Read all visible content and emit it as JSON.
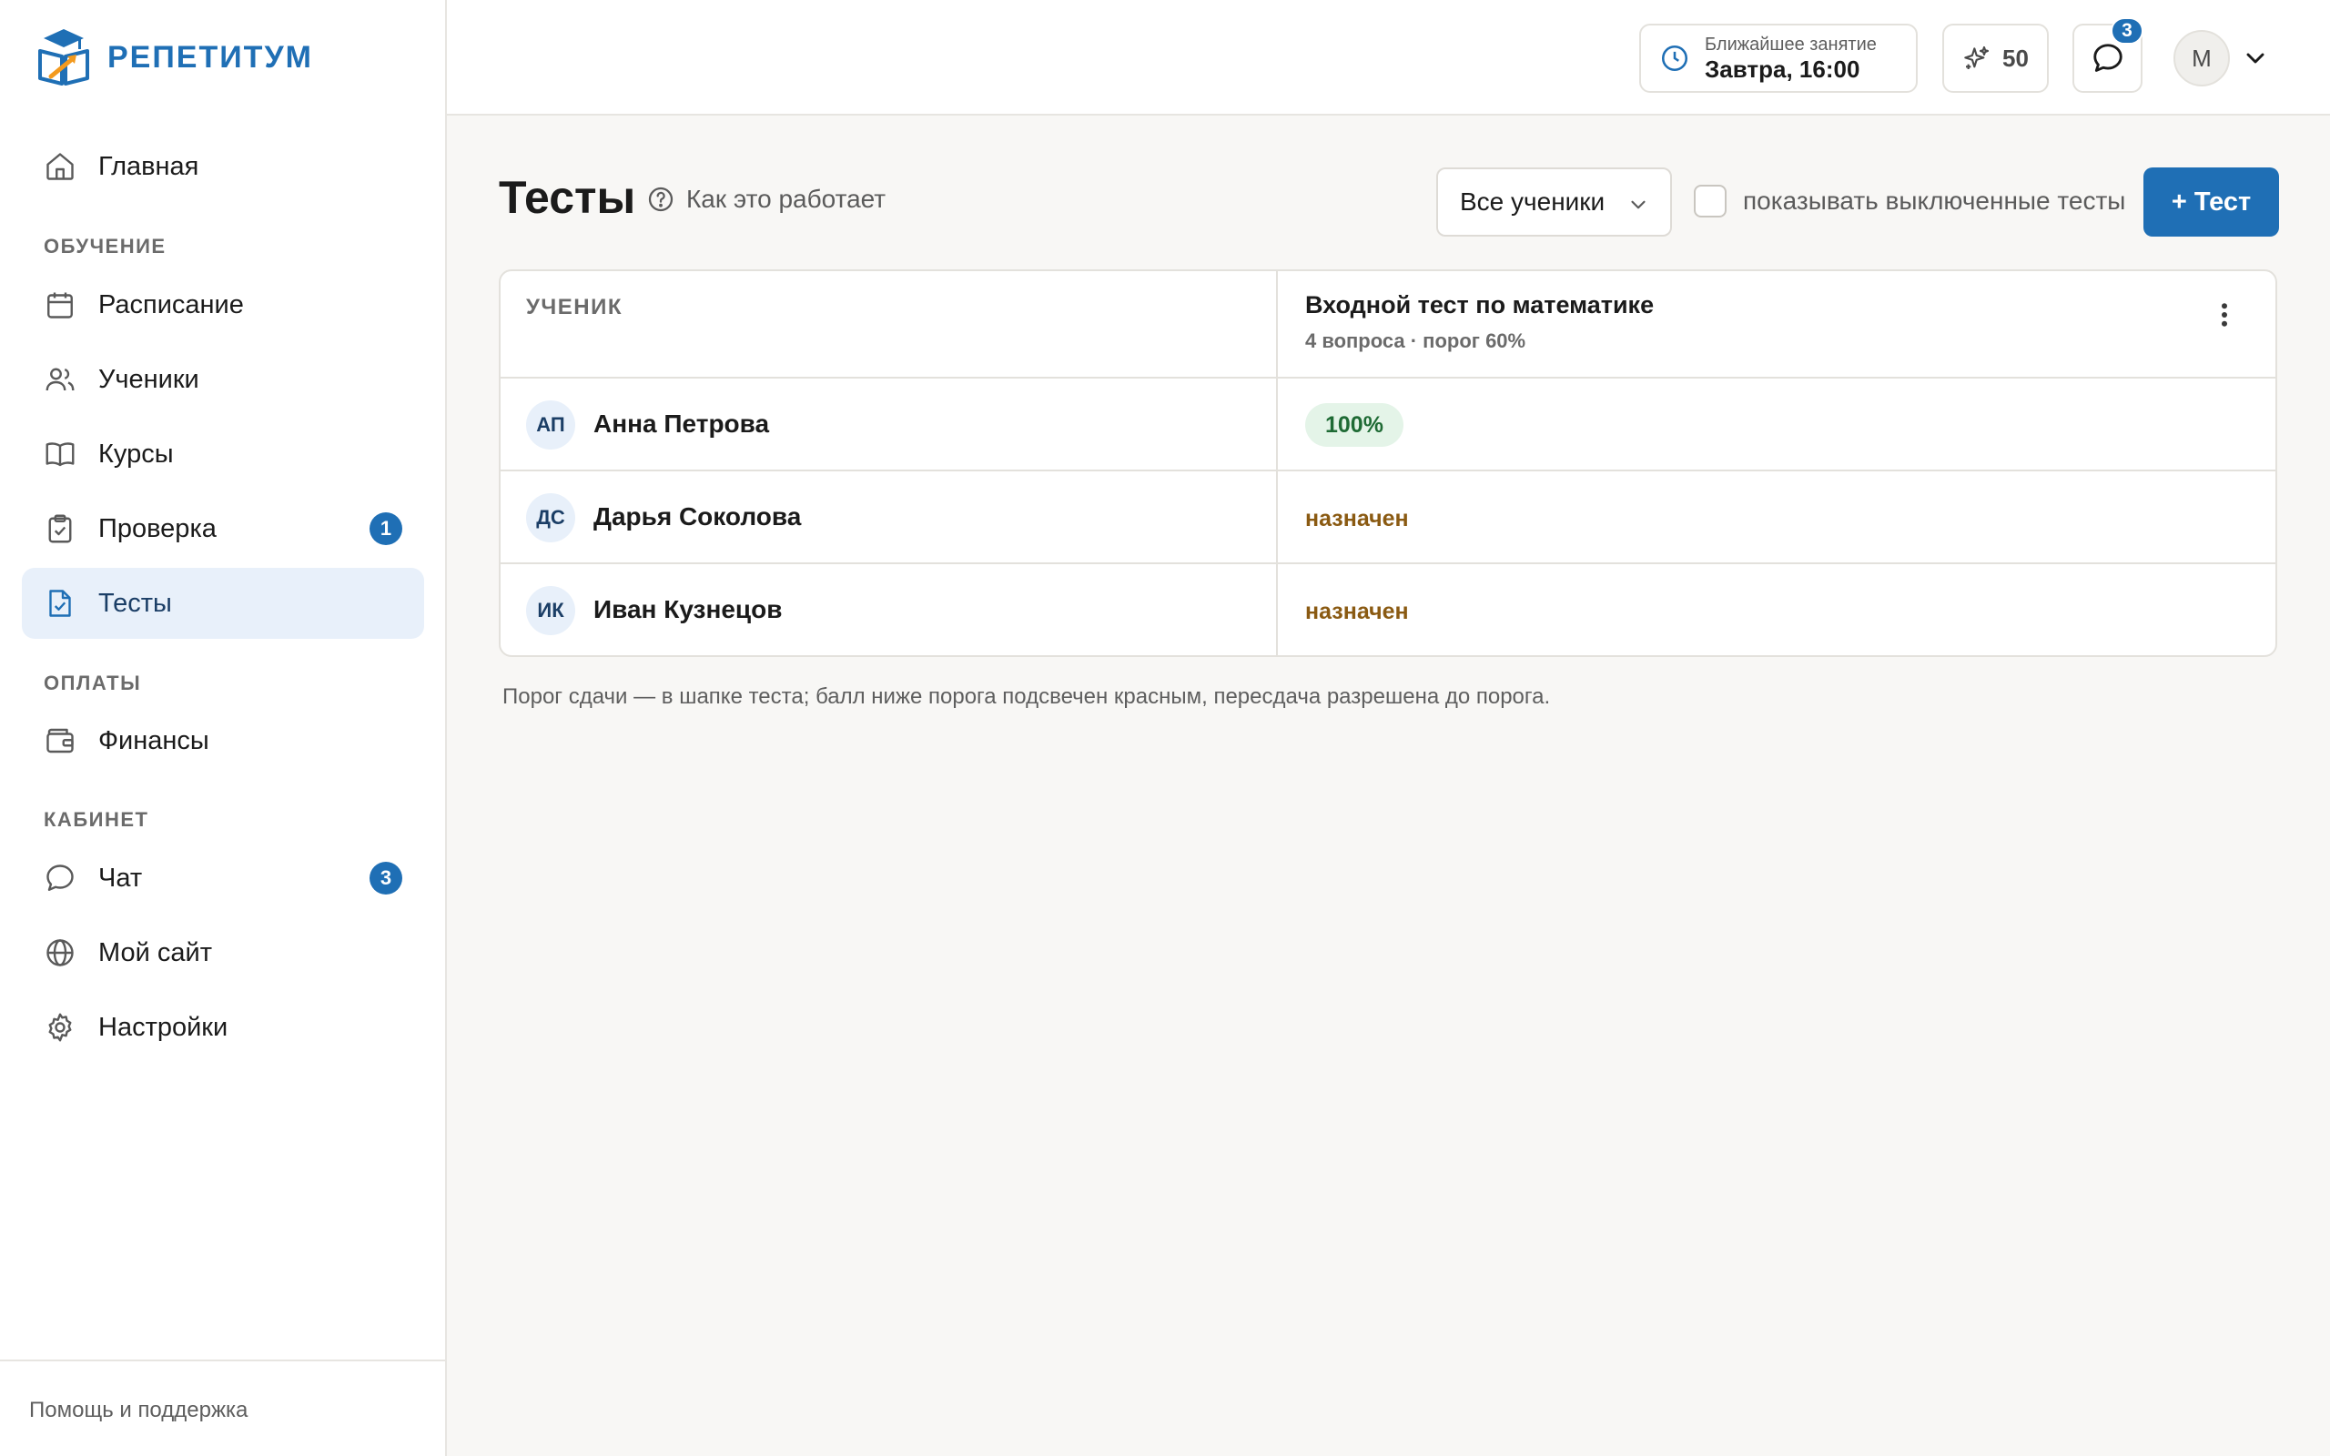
{
  "brand": {
    "name": "РЕПЕТИТУМ"
  },
  "sidebar": {
    "items": [
      {
        "label": "Главная",
        "icon": "home-icon"
      },
      {
        "label": "Расписание",
        "icon": "calendar-icon"
      },
      {
        "label": "Ученики",
        "icon": "users-icon"
      },
      {
        "label": "Курсы",
        "icon": "book-icon"
      },
      {
        "label": "Проверка",
        "icon": "clipboard-check-icon",
        "badge": "1"
      },
      {
        "label": "Тесты",
        "icon": "file-check-icon",
        "active": true
      },
      {
        "label": "Финансы",
        "icon": "wallet-icon"
      },
      {
        "label": "Чат",
        "icon": "chat-icon",
        "badge": "3"
      },
      {
        "label": "Мой сайт",
        "icon": "globe-icon"
      },
      {
        "label": "Настройки",
        "icon": "gear-icon"
      }
    ],
    "sections": {
      "learning": "ОБУЧЕНИЕ",
      "payments": "ОПЛАТЫ",
      "cabinet": "КАБИНЕТ"
    },
    "footer": {
      "help": "Помощь и поддержка"
    }
  },
  "header": {
    "next_lesson_label": "Ближайшее занятие",
    "next_lesson_value": "Завтра, 16:00",
    "points": "50",
    "chat_badge": "3",
    "avatar_initial": "М"
  },
  "main": {
    "title": "Тесты",
    "how_it_works": "Как это работает",
    "filter_value": "Все ученики",
    "show_disabled_label": "показывать выключенные тесты",
    "add_test_label": "+ Тест",
    "table": {
      "student_header": "УЧЕНИК",
      "test_title": "Входной тест по математике",
      "test_sub": "4 вопроса · порог 60%",
      "rows": [
        {
          "initials": "АП",
          "name": "Анна Петрова",
          "result": "100%",
          "status": "score"
        },
        {
          "initials": "ДС",
          "name": "Дарья Соколова",
          "result": "назначен",
          "status": "assigned"
        },
        {
          "initials": "ИК",
          "name": "Иван Кузнецов",
          "result": "назначен",
          "status": "assigned"
        }
      ]
    },
    "footnote": "Порог сдачи — в шапке теста; балл ниже порога подсвечен красным, пересдача разрешена до порога."
  },
  "colors": {
    "accent": "#1f6fb5",
    "active_bg": "#e8f0fa",
    "score_bg": "#e4f4e8",
    "score_text": "#1f6b35",
    "assigned_text": "#8a5a12"
  }
}
